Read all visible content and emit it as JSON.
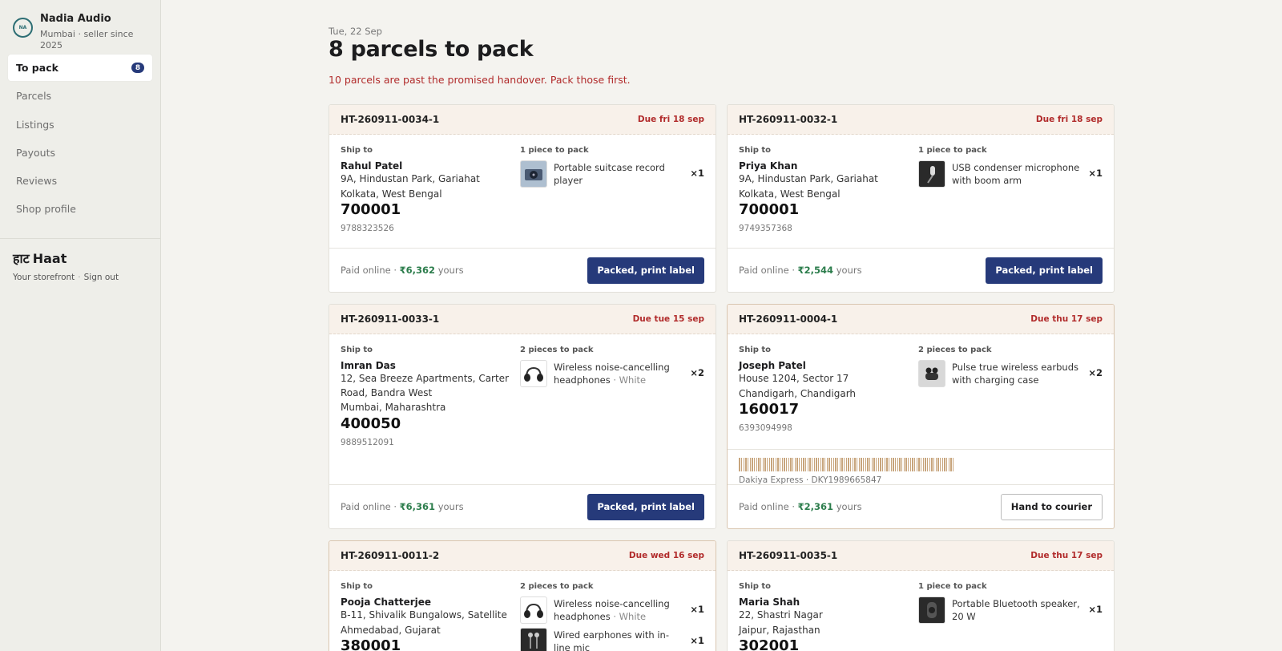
{
  "sidebar": {
    "shop_initials": "NA",
    "shop_name": "Nadia Audio",
    "shop_sub": "Mumbai · seller since 2025",
    "nav": [
      {
        "label": "To pack",
        "badge": "8"
      },
      {
        "label": "Parcels"
      },
      {
        "label": "Listings"
      },
      {
        "label": "Payouts"
      },
      {
        "label": "Reviews"
      },
      {
        "label": "Shop profile"
      }
    ],
    "brand_deva": "हाट",
    "brand_name": "Haat",
    "storefront_link": "Your storefront",
    "signout_link": "Sign out"
  },
  "header": {
    "date": "Tue, 22 Sep",
    "title": "8 parcels to pack",
    "alert": "10 parcels are past the promised handover. Pack those first."
  },
  "labels": {
    "ship_to": "Ship to",
    "paid_online": "Paid online ·",
    "yours": "yours",
    "packed_btn": "Packed, print label",
    "hand_btn": "Hand to courier"
  },
  "cards": [
    {
      "id": "HT-260911-0034-1",
      "due": "Due fri 18 sep",
      "name": "Rahul Patel",
      "addr1": "9A, Hindustan Park, Gariahat",
      "addr2": "Kolkata, West Bengal",
      "pin": "700001",
      "phone": "9788323526",
      "pieces": "1 piece to pack",
      "items": [
        {
          "name": "Portable suitcase record player",
          "variant": "",
          "qty": "×1"
        }
      ],
      "amount": "₹6,362"
    },
    {
      "id": "HT-260911-0032-1",
      "due": "Due fri 18 sep",
      "name": "Priya Khan",
      "addr1": "9A, Hindustan Park, Gariahat",
      "addr2": "Kolkata, West Bengal",
      "pin": "700001",
      "phone": "9749357368",
      "pieces": "1 piece to pack",
      "items": [
        {
          "name": "USB condenser microphone with boom arm",
          "variant": "",
          "qty": "×1"
        }
      ],
      "amount": "₹2,544"
    },
    {
      "id": "HT-260911-0033-1",
      "due": "Due tue 15 sep",
      "name": "Imran Das",
      "addr1": "12, Sea Breeze Apartments, Carter Road, Bandra West",
      "addr2": "Mumbai, Maharashtra",
      "pin": "400050",
      "phone": "9889512091",
      "pieces": "2 pieces to pack",
      "items": [
        {
          "name": "Wireless noise-cancelling headphones",
          "variant": " · White",
          "qty": "×2"
        }
      ],
      "amount": "₹6,361"
    },
    {
      "id": "HT-260911-0004-1",
      "due": "Due thu 17 sep",
      "name": "Joseph Patel",
      "addr1": "House 1204, Sector 17",
      "addr2": "Chandigarh, Chandigarh",
      "pin": "160017",
      "phone": "6393094998",
      "pieces": "2 pieces to pack",
      "items": [
        {
          "name": "Pulse true wireless earbuds with charging case",
          "variant": "",
          "qty": "×2"
        }
      ],
      "amount": "₹2,361",
      "courier": "Dakiya Express · DKY1989665847"
    },
    {
      "id": "HT-260911-0011-2",
      "due": "Due wed 16 sep",
      "name": "Pooja Chatterjee",
      "addr1": "B-11, Shivalik Bungalows, Satellite",
      "addr2": "Ahmedabad, Gujarat",
      "pin": "380001",
      "phone": "",
      "pieces": "2 pieces to pack",
      "items": [
        {
          "name": "Wireless noise-cancelling headphones",
          "variant": " · White",
          "qty": "×1"
        },
        {
          "name": "Wired earphones with in-line mic",
          "variant": "",
          "qty": "×1"
        }
      ],
      "amount": ""
    },
    {
      "id": "HT-260911-0035-1",
      "due": "Due thu 17 sep",
      "name": "Maria Shah",
      "addr1": "22, Shastri Nagar",
      "addr2": "Jaipur, Rajasthan",
      "pin": "302001",
      "phone": "",
      "pieces": "1 piece to pack",
      "items": [
        {
          "name": "Portable Bluetooth speaker, 20 W",
          "variant": "",
          "qty": "×1"
        }
      ],
      "amount": ""
    }
  ]
}
